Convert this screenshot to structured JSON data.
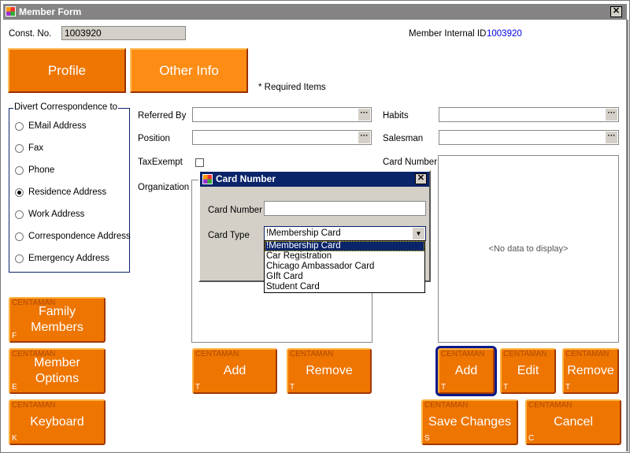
{
  "window": {
    "title": "Member Form",
    "close": "✕"
  },
  "header": {
    "const_label": "Const. No.",
    "const_value": "1003920",
    "internal_label": "Member Internal ID",
    "internal_value": "1003920",
    "required_note": "* Required Items"
  },
  "tabs": [
    {
      "label": "Profile"
    },
    {
      "label": "Other Info"
    }
  ],
  "divert": {
    "legend": "Divert Correspondence to",
    "options": [
      "EMail Address",
      "Fax",
      "Phone",
      "Residence Address",
      "Work Address",
      "Correspondence Address",
      "Emergency Address"
    ],
    "selected": "Residence Address"
  },
  "fields": {
    "referred_by": "Referred By",
    "position": "Position",
    "tax_exempt": "TaxExempt",
    "organization": "Organization",
    "habits": "Habits",
    "salesman": "Salesman",
    "card_number": "Card Number",
    "ellipsis": "···",
    "no_data": "<No data to display>"
  },
  "brand": "CENTAMAN",
  "buttons": {
    "family": {
      "label": "Family Members",
      "key": "F"
    },
    "options": {
      "label": "Member Options",
      "key": "E"
    },
    "keyboard": {
      "label": "Keyboard",
      "key": "K"
    },
    "org_add": {
      "label": "Add",
      "key": "T"
    },
    "org_remove": {
      "label": "Remove",
      "key": "T"
    },
    "card_add": {
      "label": "Add",
      "key": "T"
    },
    "card_edit": {
      "label": "Edit",
      "key": "T"
    },
    "card_remove": {
      "label": "Remove",
      "key": "T"
    },
    "save": {
      "label": "Save Changes",
      "key": "S"
    },
    "cancel": {
      "label": "Cancel",
      "key": "C"
    }
  },
  "dialog": {
    "title": "Card Number",
    "card_number_label": "Card Number",
    "card_number_value": "",
    "card_type_label": "Card Type",
    "card_type_value": "!Membership Card",
    "options": [
      "!Membership Card",
      "Car Registration",
      "Chicago Ambassador Card",
      "GIft Card",
      "Student Card"
    ]
  }
}
